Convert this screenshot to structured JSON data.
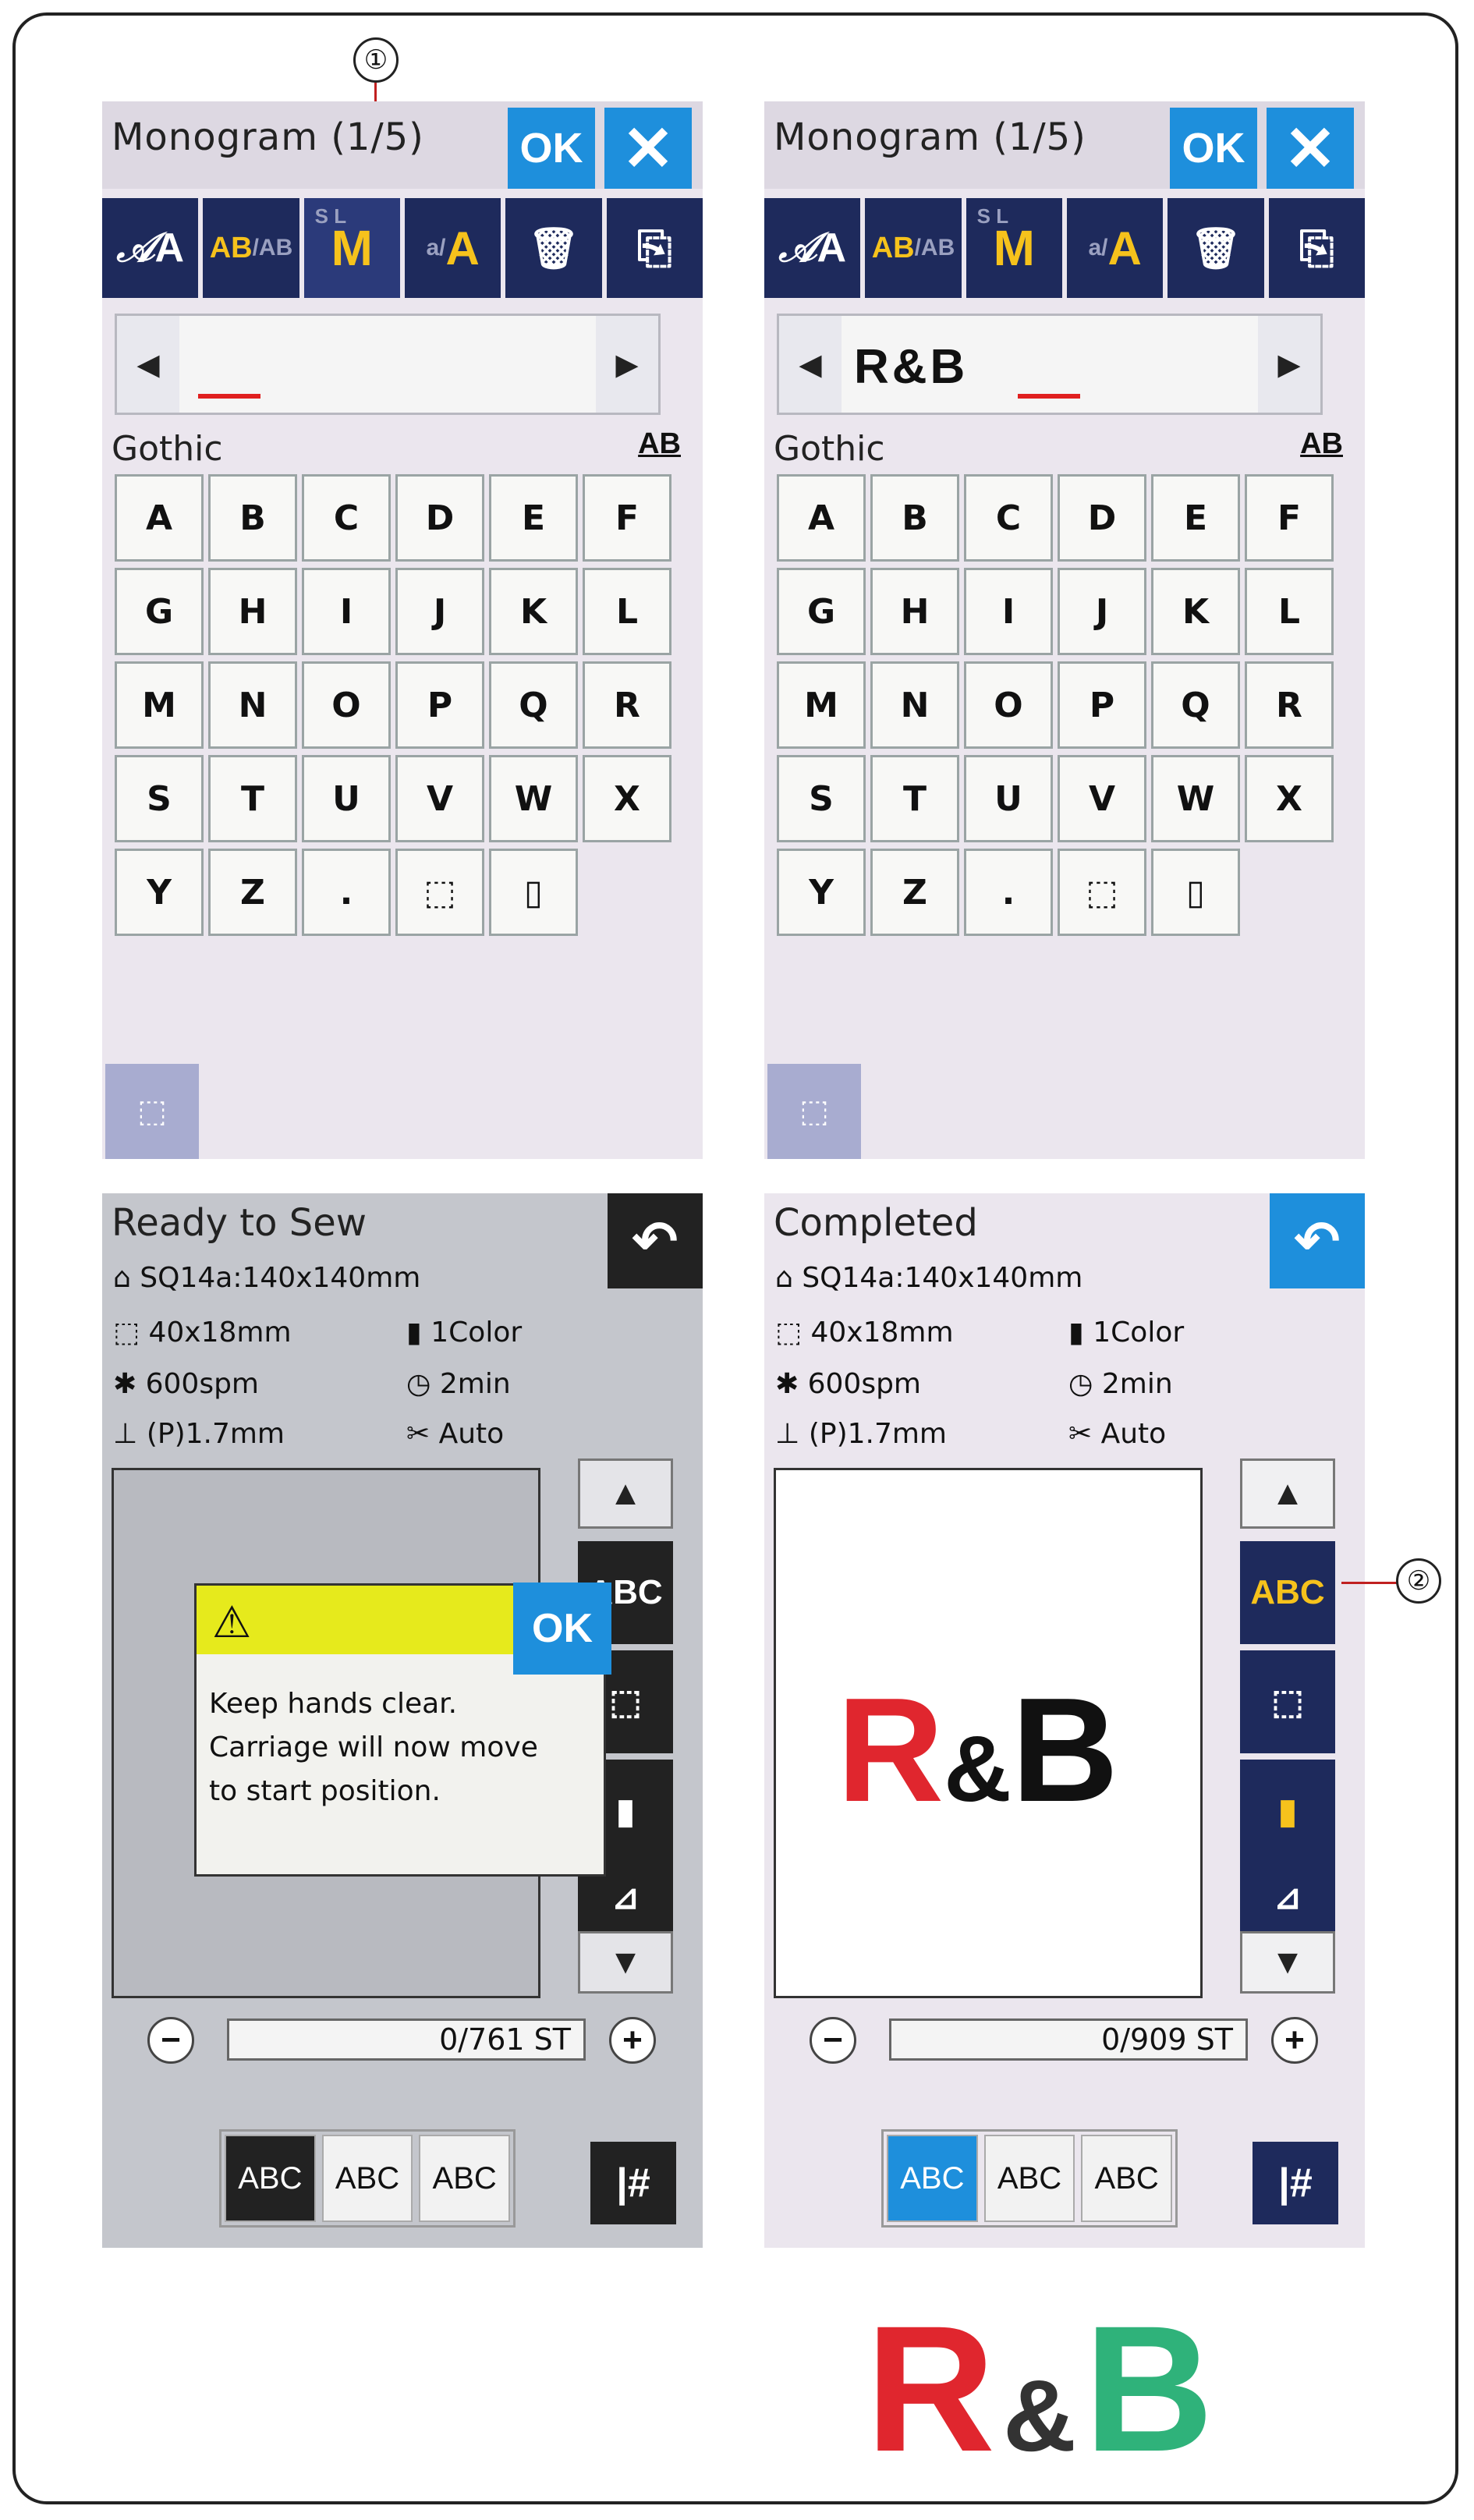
{
  "callouts": {
    "one": "①",
    "two": "②"
  },
  "monogram_screen": {
    "title": "Monogram (1/5)",
    "ok_label": "OK",
    "close_label": "✕",
    "font_name": "Gothic",
    "case_icon_label": "AB",
    "keys": [
      "A",
      "B",
      "C",
      "D",
      "E",
      "F",
      "G",
      "H",
      "I",
      "J",
      "K",
      "L",
      "M",
      "N",
      "O",
      "P",
      "Q",
      "R",
      "S",
      "T",
      "U",
      "V",
      "W",
      "X",
      "Y",
      "Z",
      ".",
      "⬚",
      "▯"
    ]
  },
  "left_top": {
    "entry_text": ""
  },
  "right_top": {
    "entry_text": "R&B"
  },
  "ready_screen": {
    "title": "Ready to Sew",
    "hoop": "SQ14a:140x140mm",
    "size": "40x18mm",
    "colors": "1Color",
    "speed": "600spm",
    "time": "2min",
    "presser": "(P)1.7mm",
    "cutter": "Auto",
    "stitch_count": "0/761 ST",
    "dialog": {
      "ok_label": "OK",
      "line1": "Keep hands clear.",
      "line2": "Carriage will now move",
      "line3": "to start position."
    }
  },
  "completed_screen": {
    "title": "Completed",
    "hoop": "SQ14a:140x140mm",
    "size": "40x18mm",
    "colors": "1Color",
    "speed": "600spm",
    "time": "2min",
    "presser": "(P)1.7mm",
    "cutter": "Auto",
    "stitch_count": "0/909 ST",
    "preview_text": {
      "r": "R",
      "amp": "&",
      "b": "B"
    }
  },
  "abc_buttons": [
    "ABC",
    "ABC",
    "ABC"
  ],
  "final_result": {
    "r": "R",
    "amp": "&",
    "b": "B"
  },
  "colors": {
    "accent_blue": "#1e8fdc",
    "navy": "#1e2a5c",
    "red": "#e0262e",
    "green": "#2fb27a",
    "warning_yellow": "#e6ea1c"
  }
}
